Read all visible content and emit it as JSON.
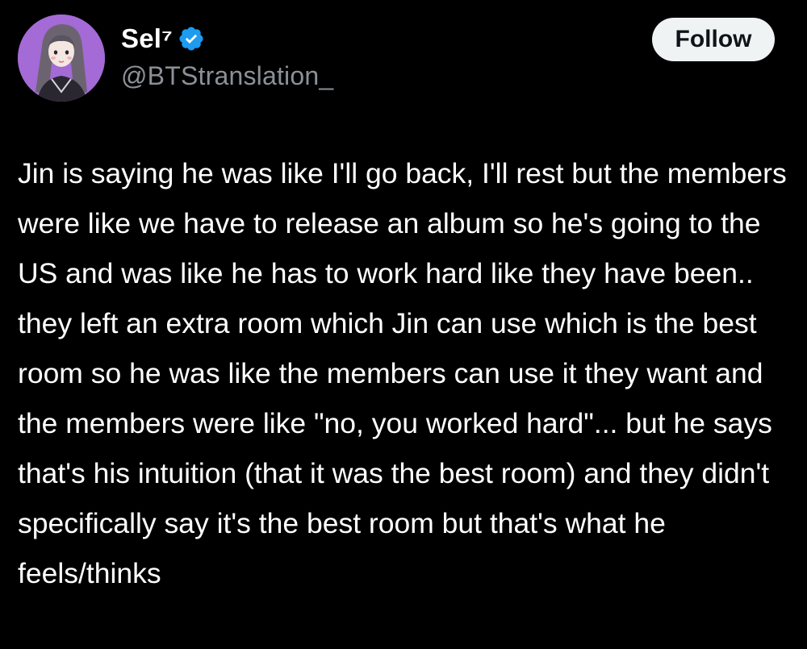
{
  "author": {
    "display_name": "Sel⁷",
    "handle": "@BTStranslation_",
    "verified_icon": "verified-badge-icon",
    "avatar_icon": "illustrated-girl-avatar"
  },
  "actions": {
    "follow_label": "Follow"
  },
  "tweet": {
    "text": "Jin is saying he was like I'll go back, I'll rest but the members were like we have to release an album so he's going to the US and was like he has to work hard like they have been.. they left an extra room which Jin can use which is the best room so he was like the members can use it they want and the members were like \"no, you worked hard\"... but he says that's his intuition (that it was the best room) and they didn't specifically say it's the best room but that's what he feels/thinks"
  },
  "colors": {
    "background": "#000000",
    "verified": "#1d9bf0",
    "follow_bg": "#eff3f4",
    "handle": "#8b9197",
    "avatar_bg": "#a46ad6"
  }
}
